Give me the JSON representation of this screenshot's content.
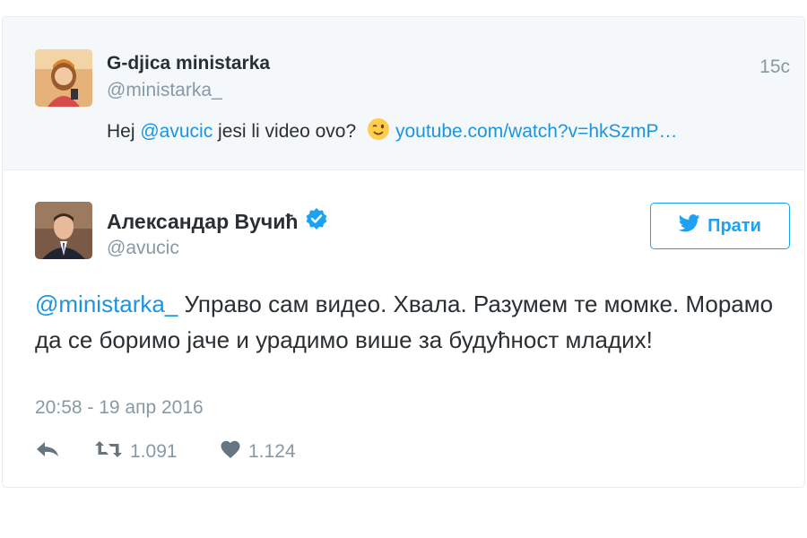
{
  "parent_tweet": {
    "name": "G-djica ministarka",
    "handle": "@ministarka_",
    "time": "15с",
    "text_prefix": "Hej ",
    "mention": "@avucic",
    "text_mid": " jesi li video ovo?",
    "link": "youtube.com/watch?v=hkSzmP…",
    "emoji_icon": "winking-face-emoji"
  },
  "main_tweet": {
    "name": "Александар Вучић",
    "verified_icon": "verified-badge-icon",
    "handle": "@avucic",
    "follow_label": "Прати",
    "mention": "@ministarka_",
    "text": " Управо сам видео. Хвала. Разумем те момке. Морамо да се боримо јаче и урадимо више за будућност младих!",
    "timestamp": "20:58 - 19 апр 2016",
    "retweets": "1.091",
    "likes": "1.124"
  },
  "colors": {
    "link": "#1b95e0",
    "muted": "#8899a6",
    "accent": "#1da1f2",
    "parent_bg": "#f5f8fa"
  }
}
